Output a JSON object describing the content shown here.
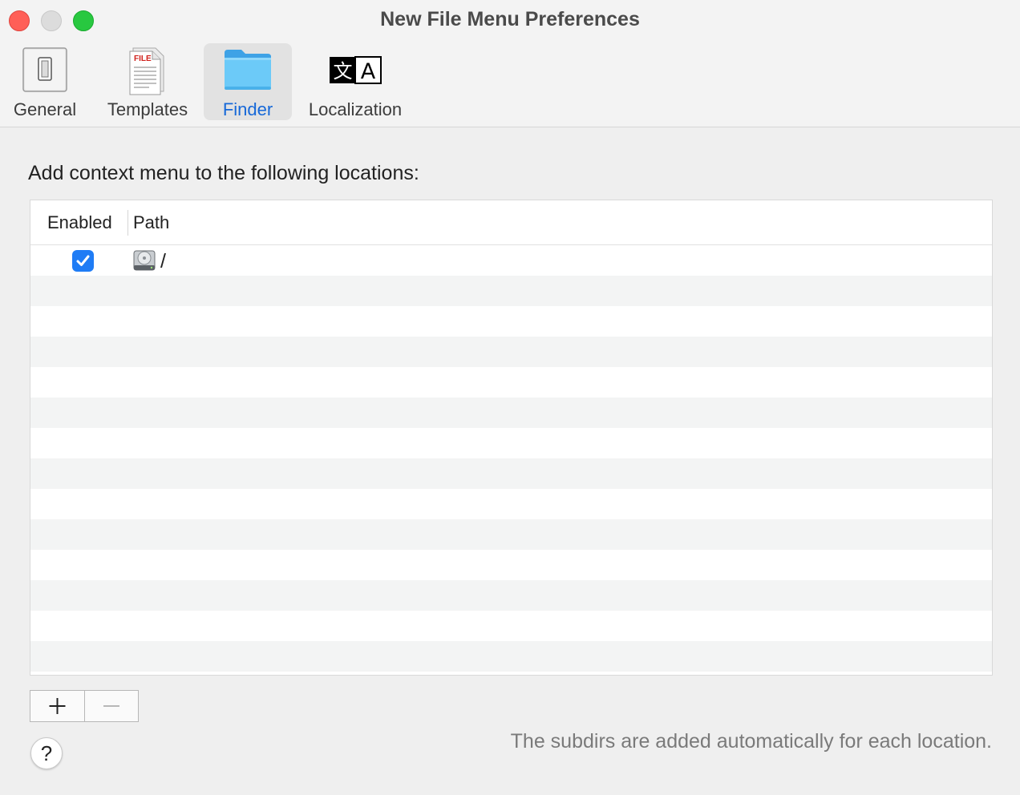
{
  "window": {
    "title": "New File Menu Preferences"
  },
  "toolbar": {
    "items": [
      {
        "label": "General",
        "icon": "switch-icon",
        "selected": false
      },
      {
        "label": "Templates",
        "icon": "file-template-icon",
        "selected": false
      },
      {
        "label": "Finder",
        "icon": "folder-icon",
        "selected": true
      },
      {
        "label": "Localization",
        "icon": "translate-icon",
        "selected": false
      }
    ],
    "templates_icon_text": "FILE",
    "localization_icon_glyphs": [
      "文",
      "A"
    ]
  },
  "content": {
    "section_label": "Add context menu to the following locations:",
    "table": {
      "columns": [
        "Enabled",
        "Path"
      ],
      "rows": [
        {
          "enabled": true,
          "icon": "disk-icon",
          "path": "/"
        }
      ]
    },
    "add_button_label": "+",
    "remove_button_label": "—",
    "help_label": "?",
    "footnote": "The subdirs are added automatically for each location."
  },
  "colors": {
    "accent": "#1f7cf5",
    "selected_label": "#1668d8",
    "close": "#ff5f57",
    "minimize": "#dcdcdc",
    "maximize": "#28c840"
  }
}
